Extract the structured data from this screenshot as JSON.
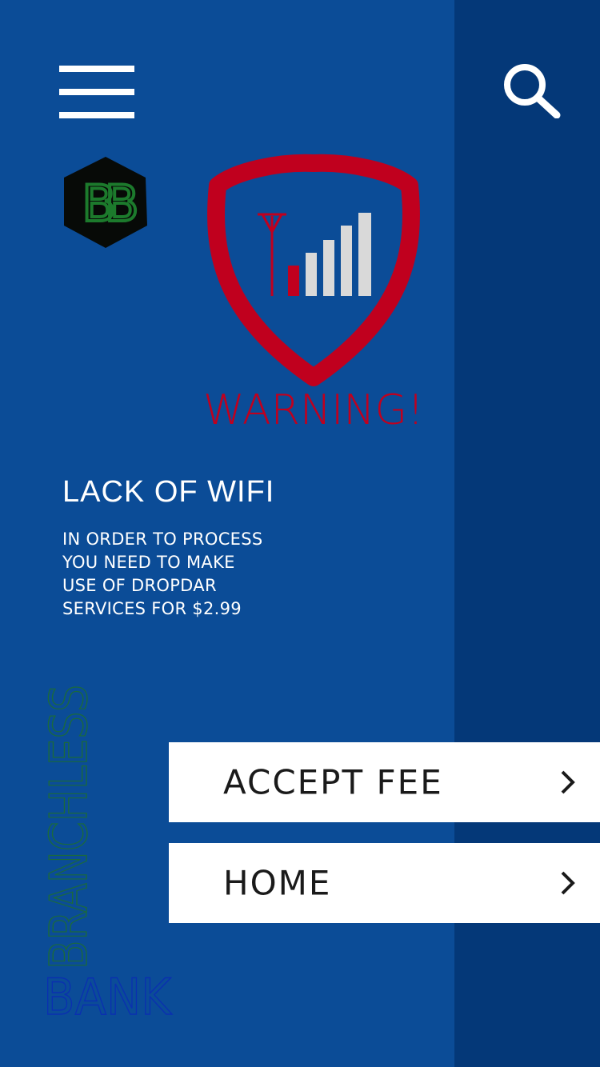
{
  "colors": {
    "background": "#0b4c97",
    "side_panel": "#043878",
    "warning_red": "#c0001e",
    "button_bg": "#ffffff",
    "brand_blue": "#0a2fb0",
    "logo_green": "#1c7a2c"
  },
  "header": {
    "menu_icon": "hamburger-menu-icon",
    "search_icon": "search-icon"
  },
  "logo": {
    "text": "BB"
  },
  "warning": {
    "icon": "no-signal-shield-icon",
    "title": "WARNING!"
  },
  "message": {
    "title": "LACK OF WIFI",
    "body_lines": [
      "IN ORDER TO PROCESS",
      "YOU NEED TO MAKE",
      "USE OF DROPDAR",
      "SERVICES FOR $2.99"
    ]
  },
  "actions": {
    "accept_label": "ACCEPT FEE",
    "home_label": "HOME",
    "chevron_icon": "chevron-right-icon"
  },
  "brand": {
    "line1": "BRANCHLESS",
    "line2": "BANK"
  }
}
